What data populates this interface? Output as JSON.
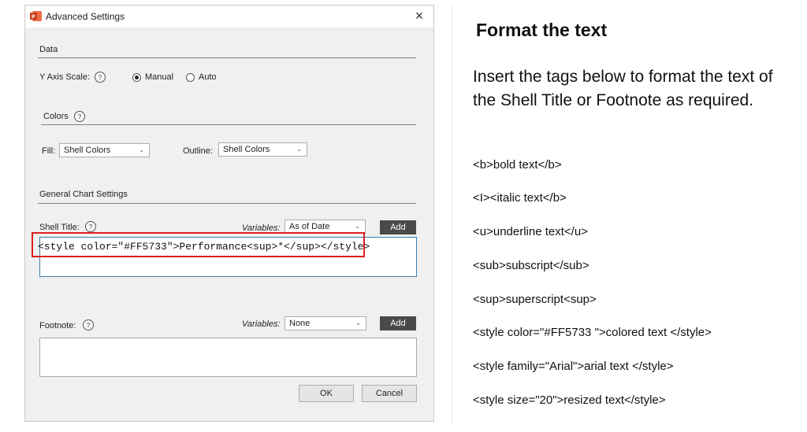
{
  "dialog": {
    "title": "Advanced Settings",
    "close_glyph": "×",
    "data_section": {
      "label": "Data"
    },
    "y_axis": {
      "label": "Y Axis Scale:",
      "help": "?",
      "options": [
        "Manual",
        "Auto"
      ],
      "selected": "Manual"
    },
    "colors_section": {
      "label": "Colors",
      "help": "?"
    },
    "fill": {
      "label": "Fill:",
      "value": "Shell Colors"
    },
    "outline": {
      "label": "Outline:",
      "value": "Shell Colors"
    },
    "general_section": {
      "label": "General Chart Settings"
    },
    "shell_title": {
      "label": "Shell Title:",
      "help": "?",
      "variables_label": "Variables:",
      "variables_value": "As of Date",
      "add_label": "Add",
      "text": "<style color=\"#FF5733\">Performance<sup>*</sup></style>"
    },
    "footnote": {
      "label": "Footnote:",
      "help": "?",
      "variables_label": "Variables:",
      "variables_value": "None",
      "add_label": "Add",
      "text": ""
    },
    "ok_label": "OK",
    "cancel_label": "Cancel"
  },
  "instructions": {
    "heading": "Format the text",
    "intro": "Insert the tags below to format the text of the Shell Title or Footnote as required.",
    "tags": [
      "<b>bold text</b>",
      "<I><italic text</b>",
      "<u>underline text</u>",
      "<sub>subscript</sub>",
      "<sup>superscript<sup>",
      "<style color=\"#FF5733 \">colored text </style>",
      "<style family=\"Arial\">arial text </style>",
      "<style size=\"20\">resized text</style>"
    ]
  },
  "colors": {
    "highlight": "#e01e1e",
    "button_dark": "#4a4a4a",
    "dialog_bg": "#f0f0f0"
  },
  "icons": [
    "powerpoint-app-icon",
    "close-icon",
    "help-icon",
    "chevron-down-icon"
  ]
}
